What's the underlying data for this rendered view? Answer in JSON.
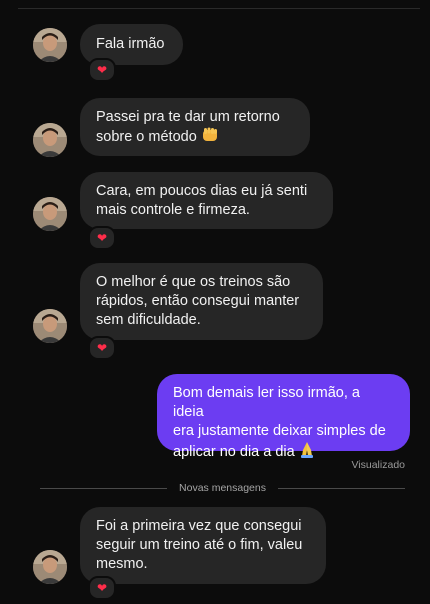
{
  "messages": [
    {
      "text": "Fala irmão",
      "reaction": "❤"
    },
    {
      "text": "Passei pra te dar um retorno\nsobre o método",
      "emoji": "fist-emoji"
    },
    {
      "text": "Cara, em poucos dias eu já senti\nmais controle e firmeza.",
      "reaction": "❤"
    },
    {
      "text": "O melhor é que os treinos são\nrápidos, então consegui manter\nsem dificuldade.",
      "reaction": "❤"
    },
    {
      "text": "Foi a primeira vez que consegui\nseguir um treino até o fim, valeu\nmesmo.",
      "reaction": "❤"
    }
  ],
  "outgoing": {
    "text": "Bom demais ler isso irmão, a ideia\nera justamente deixar simples de\naplicar no dia a dia",
    "emoji": "praying-hands-emoji",
    "status": "Visualizado"
  },
  "divider_label": "Novas mensagens",
  "colors": {
    "background": "#0c0c0c",
    "incoming_bubble": "#262626",
    "outgoing_bubble": "#6c3df2",
    "reaction_heart": "#ff2d4a"
  }
}
